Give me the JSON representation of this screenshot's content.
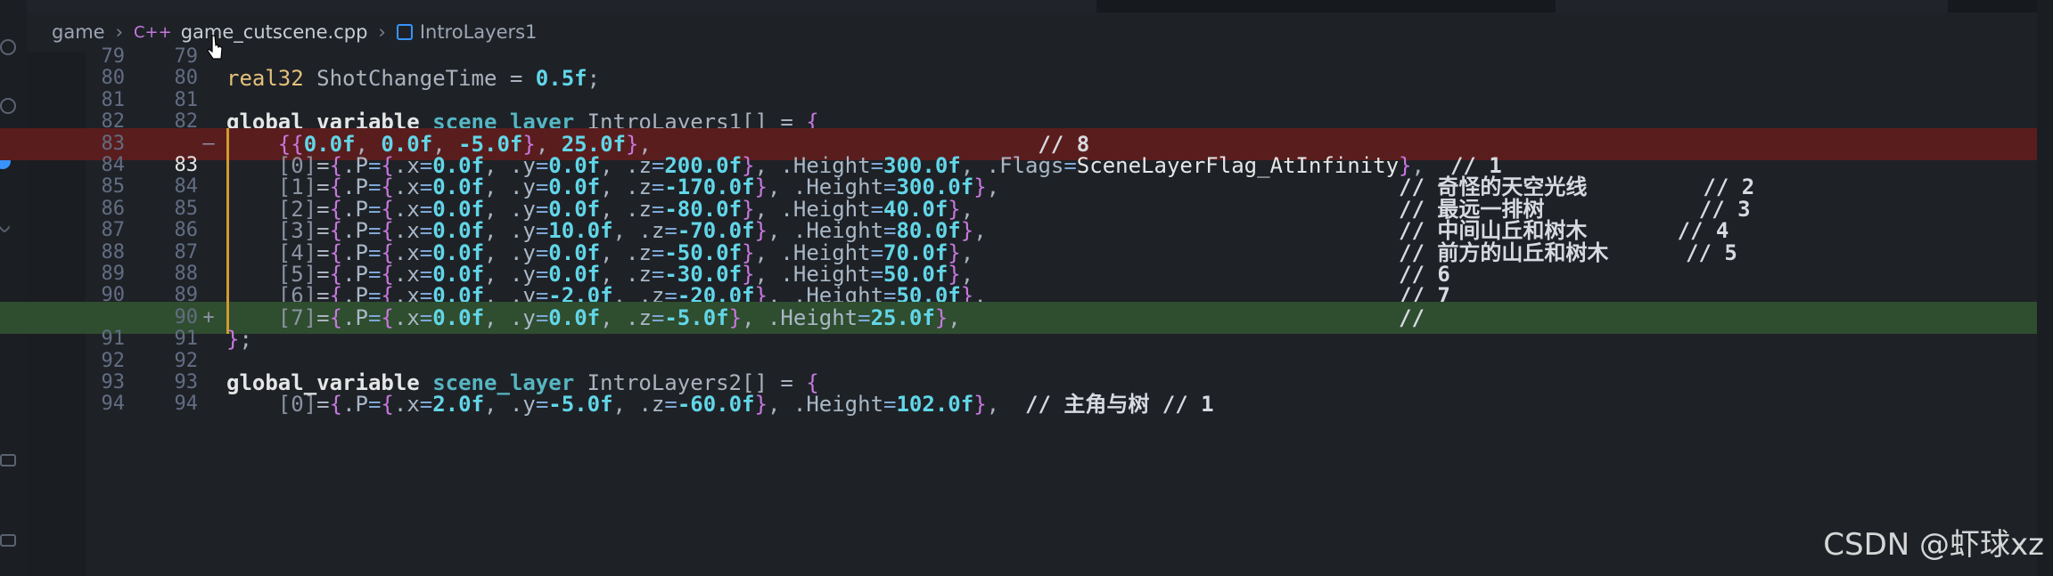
{
  "breadcrumb": {
    "folder": "game",
    "file_icon": "C++",
    "file": "game_cutscene.cpp",
    "symbol_icon": "symbol-variable-icon",
    "symbol": "IntroLayers1"
  },
  "lines": [
    {
      "left": "79",
      "right": "79",
      "type": "ctx",
      "text": ""
    },
    {
      "left": "80",
      "right": "80",
      "type": "ctx",
      "text": "real32 ShotChangeTime = 0.5f;"
    },
    {
      "left": "81",
      "right": "81",
      "type": "ctx",
      "text": ""
    },
    {
      "left": "82",
      "right": "82",
      "type": "ctx",
      "text": "global_variable scene_layer IntroLayers1[] = {"
    },
    {
      "left": "83",
      "right": "",
      "type": "del",
      "mark": "—",
      "text": "    {{0.0f, 0.0f, -5.0f}, 25.0f},                              // 8"
    },
    {
      "left": "84",
      "right": "83",
      "type": "ctx",
      "text": "    [0]={.P={.x=0.0f, .y=0.0f, .z=200.0f}, .Height=300.0f, .Flags=SceneLayerFlag_AtInfinity},  // 1"
    },
    {
      "left": "85",
      "right": "84",
      "type": "ctx",
      "text": "    [1]={.P={.x=0.0f, .y=0.0f, .z=-170.0f}, .Height=300.0f},                               // 奇怪的天空光线         // 2"
    },
    {
      "left": "86",
      "right": "85",
      "type": "ctx",
      "text": "    [2]={.P={.x=0.0f, .y=0.0f, .z=-80.0f}, .Height=40.0f},                                 // 最远一排树            // 3"
    },
    {
      "left": "87",
      "right": "86",
      "type": "ctx",
      "text": "    [3]={.P={.x=0.0f, .y=10.0f, .z=-70.0f}, .Height=80.0f},                                // 中间山丘和树木       // 4"
    },
    {
      "left": "88",
      "right": "87",
      "type": "ctx",
      "text": "    [4]={.P={.x=0.0f, .y=0.0f, .z=-50.0f}, .Height=70.0f},                                 // 前方的山丘和树木      // 5"
    },
    {
      "left": "89",
      "right": "88",
      "type": "ctx",
      "text": "    [5]={.P={.x=0.0f, .y=0.0f, .z=-30.0f}, .Height=50.0f},                                 // 6"
    },
    {
      "left": "90",
      "right": "89",
      "type": "ctx",
      "text": "    [6]={.P={.x=0.0f, .y=-2.0f, .z=-20.0f}, .Height=50.0f},                                // 7"
    },
    {
      "left": "",
      "right": "90",
      "type": "add",
      "mark": "+",
      "text": "    [7]={.P={.x=0.0f, .y=0.0f, .z=-5.0f}, .Height=25.0f},                                  //"
    },
    {
      "left": "91",
      "right": "91",
      "type": "ctx",
      "text": "};"
    },
    {
      "left": "92",
      "right": "92",
      "type": "ctx",
      "text": ""
    },
    {
      "left": "93",
      "right": "93",
      "type": "ctx",
      "text": "global_variable scene_layer IntroLayers2[] = {"
    },
    {
      "left": "94",
      "right": "94",
      "type": "ctx",
      "text": "    [0]={.P={.x=2.0f, .y=-5.0f, .z=-60.0f}, .Height=102.0f},  // 主角与树 // 1"
    }
  ],
  "watermark": "CSDN @虾球xz"
}
